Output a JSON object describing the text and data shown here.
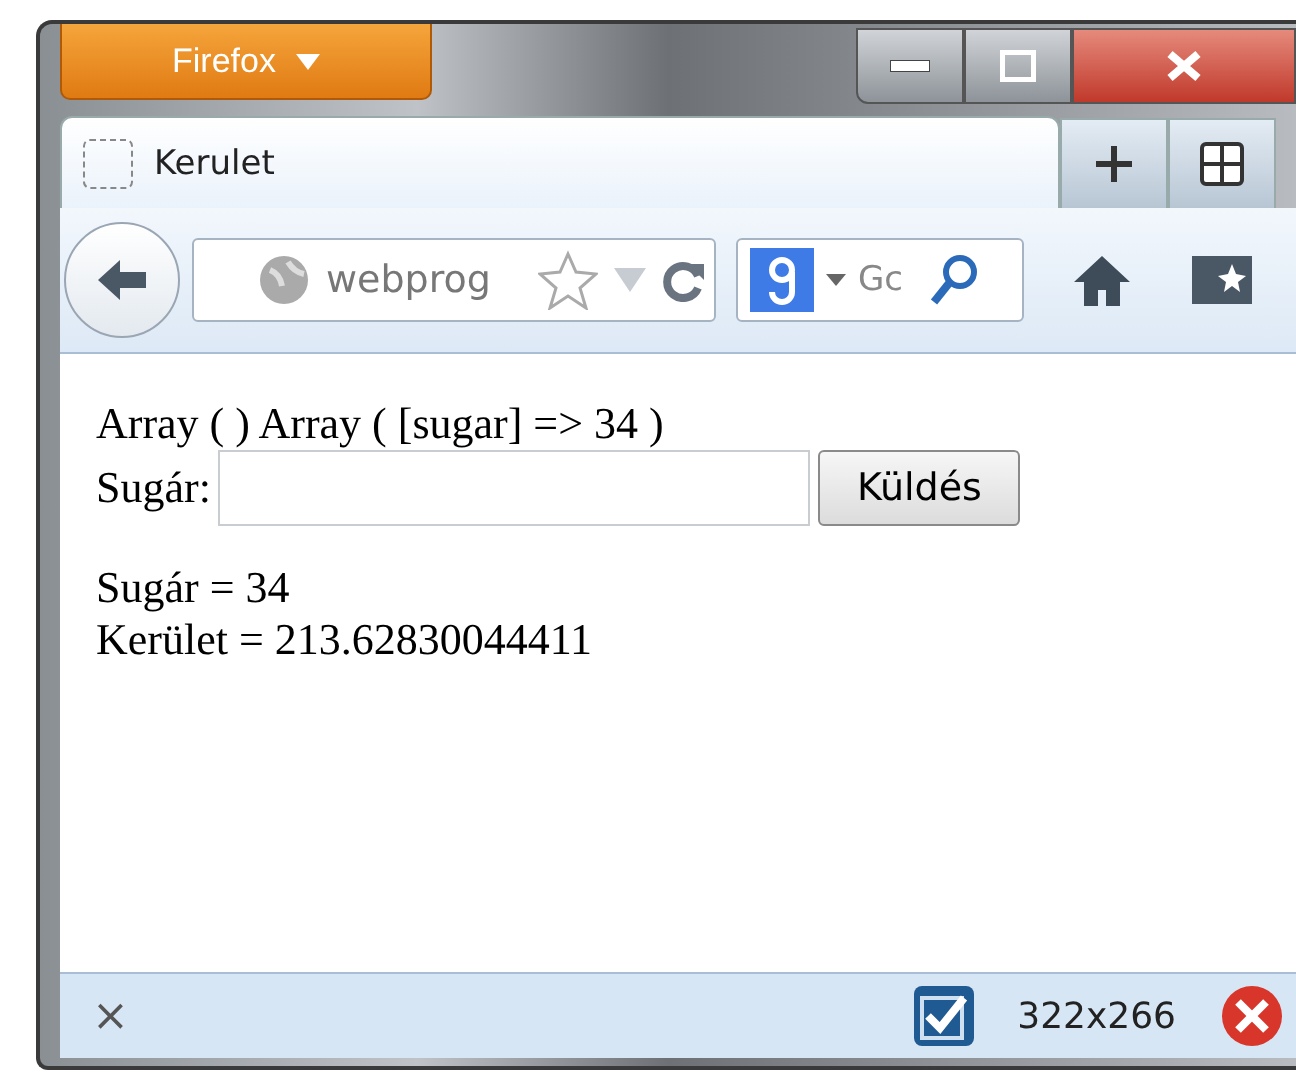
{
  "window": {
    "menu_button": "Firefox"
  },
  "tabs": [
    {
      "label": "Kerulet",
      "selected": true
    }
  ],
  "navbar": {
    "address": "webprog",
    "search_placeholder": "Gc"
  },
  "page": {
    "debug_line": "Array ( ) Array ( [sugar] => 34 )",
    "field_label": "Sugár:",
    "submit": "Küldés",
    "results": [
      "Sugár = 34",
      "Kerület = 213.62830044411"
    ]
  },
  "status_bar": {
    "close": "×",
    "size": "322x266"
  }
}
